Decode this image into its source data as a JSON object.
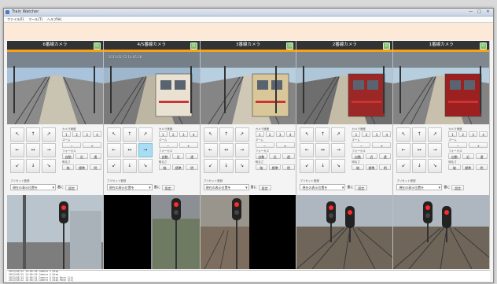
{
  "window": {
    "title": "Train Watcher",
    "controls": [
      "—",
      "□",
      "✕"
    ]
  },
  "menu": [
    "ファイル(F)",
    "ツール(T)",
    "ヘルプ(H)"
  ],
  "cameras": [
    {
      "name": "6番線カメラ",
      "timestamp": ""
    },
    {
      "name": "4/5番線カメラ",
      "timestamp": "2013-03-12 14:05:28"
    },
    {
      "name": "3番線カメラ",
      "timestamp": ""
    },
    {
      "name": "2番線カメラ",
      "timestamp": ""
    },
    {
      "name": "1番線カメラ",
      "timestamp": ""
    }
  ],
  "controls": {
    "close_icon": "⊡",
    "dpad": [
      "↖",
      "↑",
      "↗",
      "←",
      "↔",
      "→",
      "↙",
      "↓",
      "↘"
    ],
    "pan_speed_label": "カメラ速度",
    "speeds": [
      "1",
      "2",
      "3",
      "4"
    ],
    "zoom_label": "ズーム",
    "zoom_buttons": [
      "−",
      "+"
    ],
    "focus_label": "フォーカス",
    "focus_buttons": [
      "自動",
      "近",
      "遠"
    ],
    "iris_label": "明るさ",
    "iris_buttons": [
      "暗",
      "標準",
      "明"
    ],
    "preset_label": "プリセット登録",
    "preset_placeholder": "現在の表示位置を",
    "preset_save_label": "番に",
    "preset_set": "設定"
  },
  "log": [
    "2013/03/12 14:05:28 Camera 2 Disp",
    "2013/03/12 14:05:29 Camera 4 Disp",
    "2013/03/12 14:05:31 Camera 5 Disp Move 1(4)",
    "2013/03/12 14:05:33 Camera 5 Disp Move 3(4)"
  ]
}
